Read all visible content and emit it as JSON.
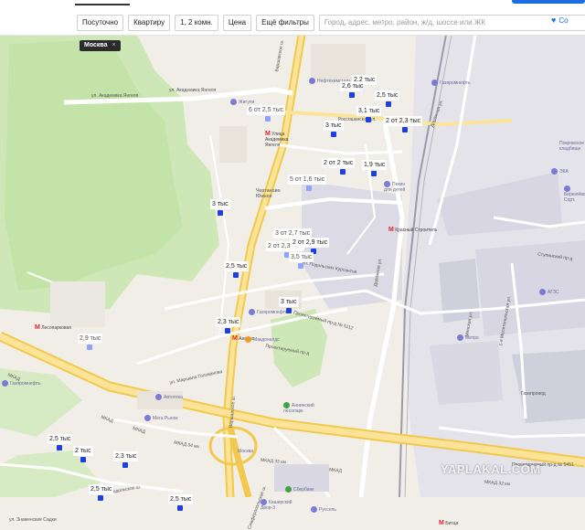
{
  "filters": {
    "daily": "Посуточно",
    "type": "Квартиру",
    "rooms": "1, 2 комн.",
    "price": "Цена",
    "more": "Ещё фильтры",
    "search_placeholder": "Город, адрес, метро, район, ж/д, шоссе или ЖК",
    "save": "Со"
  },
  "city_tag": {
    "label": "Москва",
    "close": "×"
  },
  "pins": [
    {
      "label": "2,2 тыс"
    },
    {
      "label": "2,6 тыс"
    },
    {
      "label": "2,5 тыс"
    },
    {
      "label": "6   от 2,5 тыс"
    },
    {
      "label": "3,1 тыс"
    },
    {
      "label": "2   от 2,3 тыс"
    },
    {
      "label": "3 тыс"
    },
    {
      "label": "2   от 2 тыс"
    },
    {
      "label": "1,9 тыс"
    },
    {
      "label": "5   от 1,6 тыс"
    },
    {
      "label": "3 тыс"
    },
    {
      "label": "3   от 2,7 тыс"
    },
    {
      "label": "2   от 2,3 тыс"
    },
    {
      "label": "2   от 2,9 тыс"
    },
    {
      "label": "3,5 тыс"
    },
    {
      "label": "2,5 тыс"
    },
    {
      "label": "3 тыс"
    },
    {
      "label": "2,3 тыс"
    },
    {
      "label": "2,9 тыс"
    },
    {
      "label": "2,5 тыс"
    },
    {
      "label": "2 тыс"
    },
    {
      "label": "2,3 тыс"
    },
    {
      "label": "2,5 тыс"
    },
    {
      "label": "2,5 тыс"
    }
  ],
  "pois": [
    {
      "label": "Нефтехимсталь"
    },
    {
      "label": "Газпромнефть"
    },
    {
      "label": "Жигули"
    },
    {
      "label": "Пекин для детей"
    },
    {
      "label": "Газпромнефть"
    },
    {
      "label": "Макдоналдс"
    },
    {
      "label": "Газпромнефть"
    },
    {
      "label": "Автотека"
    },
    {
      "label": "Мега Рынок"
    },
    {
      "label": "Аннинский лесопарк"
    },
    {
      "label": "Москва"
    },
    {
      "label": "Каширский Двор-3"
    },
    {
      "label": "Сбербанк"
    },
    {
      "label": "Руссель"
    },
    {
      "label": "Метро"
    },
    {
      "label": "АГЗС"
    },
    {
      "label": "ЭКА"
    },
    {
      "label": "Покровское кладбище"
    },
    {
      "label": "Бирюлёво Сорт."
    }
  ],
  "streets": [
    {
      "label": "ул. Академика Янгеля"
    },
    {
      "label": "ул. Академика Янгеля"
    },
    {
      "label": "Варшавское ш."
    },
    {
      "label": "Россошанская ул."
    },
    {
      "label": "Дорожная ул."
    },
    {
      "label": "Дорожная ул."
    },
    {
      "label": "ул. Подольских Курсантов"
    },
    {
      "label": "Проектируемый пр-д № 5112"
    },
    {
      "label": "Проектируемый пр-д"
    },
    {
      "label": "ул. Маршала Голованова"
    },
    {
      "label": "МКАД"
    },
    {
      "label": "МКАД"
    },
    {
      "label": "МКАД"
    },
    {
      "label": "МКАД 34 км"
    },
    {
      "label": "МКАД 33 км"
    },
    {
      "label": "МКАД 32 км"
    },
    {
      "label": "МКАД"
    },
    {
      "label": "Проектируемый пр-д № 5451"
    },
    {
      "label": "Варшавское ш."
    },
    {
      "label": "Симферопольское ш."
    },
    {
      "label": "Ступинский пр-д"
    },
    {
      "label": "Минская ул."
    },
    {
      "label": "1-я Мелитопольская ул."
    },
    {
      "label": "ул. Знаменские Садки"
    },
    {
      "label": "Подольское ш."
    },
    {
      "label": "Чертаново Южное"
    },
    {
      "label": "Газопровод"
    }
  ],
  "metro": [
    {
      "label": "Улица Академика Янгеля"
    },
    {
      "label": "Аннино"
    },
    {
      "label": "Лесопарковая"
    },
    {
      "label": "Красный Строитель"
    },
    {
      "label": "Битца"
    }
  ],
  "watermark": "YAPLAKAL.COM"
}
